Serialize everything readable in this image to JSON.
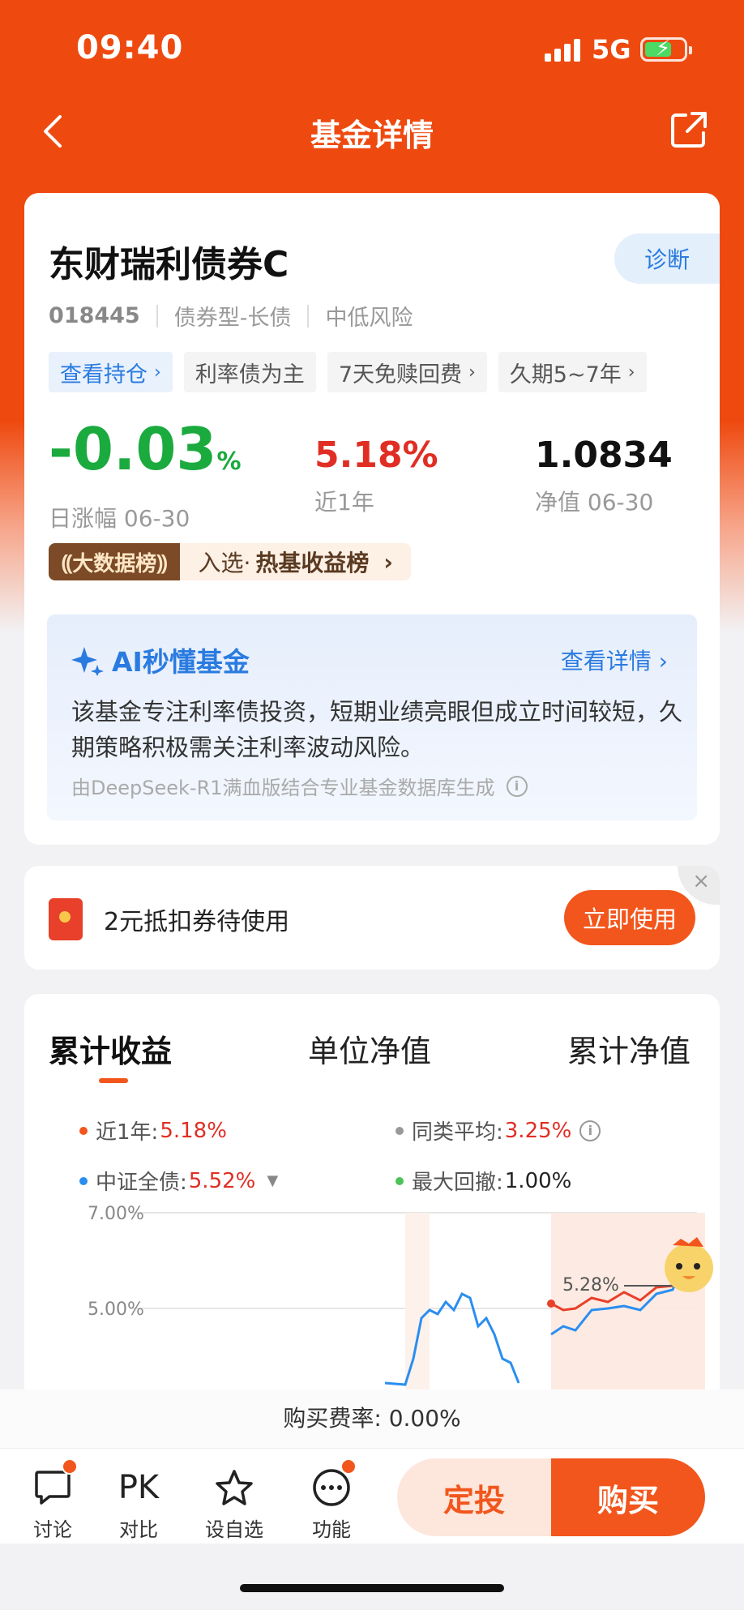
{
  "status_bar": {
    "time": "09:40",
    "network": "5G"
  },
  "nav": {
    "title": "基金详情"
  },
  "fund": {
    "name": "东财瑞利债券C",
    "diagnose_label": "诊断",
    "code": "018445",
    "type": "债券型-长债",
    "risk": "中低风险",
    "tags": [
      "查看持仓",
      "利率债为主",
      "7天免赎回费",
      "久期5~7年"
    ],
    "daily_change": {
      "value": "-0.03",
      "unit": "%",
      "label": "日涨幅 06-30"
    },
    "one_year": {
      "value": "5.18%",
      "label": "近1年"
    },
    "nav_value": {
      "value": "1.0834",
      "label": "净值 06-30"
    },
    "rank_badge": {
      "tag": "大数据榜",
      "prefix": "入选·",
      "name": "热基收益榜"
    }
  },
  "ai": {
    "title": "AI秒懂基金",
    "more": "查看详情",
    "summary": "该基金专注利率债投资，短期业绩亮眼但成立时间较短，久期策略积极需关注利率波动风险。",
    "source": "由DeepSeek-R1满血版结合专业基金数据库生成"
  },
  "coupon": {
    "text": "2元抵扣券待使用",
    "button": "立即使用",
    "close": "×"
  },
  "chart_section": {
    "tabs": [
      "累计收益",
      "单位净值",
      "累计净值"
    ],
    "legend": [
      {
        "label": "近1年:",
        "value": "5.18%",
        "color": "#f2561c"
      },
      {
        "label": "同类平均:",
        "value": "3.25%",
        "color": "#999999"
      },
      {
        "label": "中证全债:",
        "value": "5.52%",
        "color": "#2a8ef0"
      },
      {
        "label": "最大回撤:",
        "value": "1.00%",
        "color": "#4cc35a"
      }
    ]
  },
  "chart_data": {
    "type": "line",
    "ylabel_ticks": [
      "7.00%",
      "5.00%"
    ],
    "ylim": [
      0,
      7
    ],
    "annotation": "5.28%",
    "series": [
      {
        "name": "近1年",
        "color": "#f2561c",
        "values": [
          4.6,
          4.75,
          4.85,
          4.95,
          5.0,
          5.05,
          5.1,
          5.18,
          5.28
        ]
      },
      {
        "name": "中证全债",
        "color": "#2a8ef0",
        "values": [
          4.4,
          4.6,
          4.7,
          4.9,
          5.0,
          5.1,
          5.3,
          5.5,
          5.52
        ]
      }
    ]
  },
  "fee": {
    "label": "购买费率:",
    "value": "0.00%"
  },
  "bottom": {
    "discuss": "讨论",
    "compare_icon": "PK",
    "compare": "对比",
    "watch": "设自选",
    "more": "功能",
    "sip": "定投",
    "buy": "购买"
  }
}
